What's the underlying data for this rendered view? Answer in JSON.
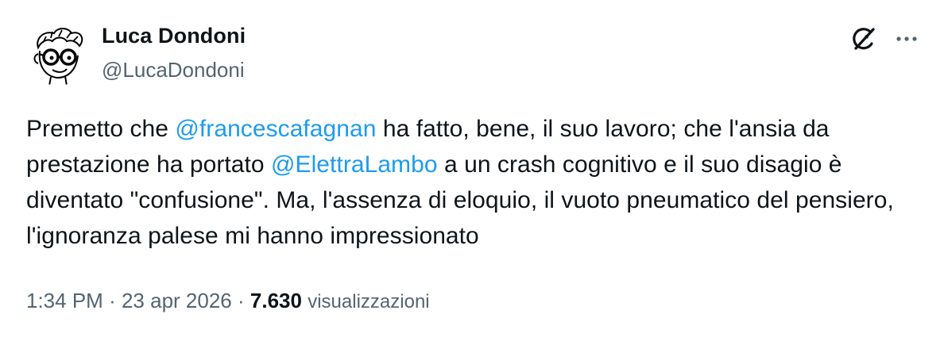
{
  "author": {
    "display_name": "Luca Dondoni",
    "handle": "@LucaDondoni"
  },
  "icons": {
    "grok": "grok-icon",
    "more": "more-options-icon"
  },
  "tweet": {
    "segments": [
      {
        "text": "Premetto che ",
        "mention": false
      },
      {
        "text": "@francescafagnan",
        "mention": true
      },
      {
        "text": " ha fatto, bene, il suo lavoro; che l'ansia da prestazione ha portato ",
        "mention": false
      },
      {
        "text": "@ElettraLambo",
        "mention": true
      },
      {
        "text": " a un crash cognitivo e il suo disagio è diventato \"confusione\". Ma, l'assenza di eloquio, il vuoto pneumatico del pensiero, l'ignoranza palese mi hanno impressionato",
        "mention": false
      }
    ]
  },
  "meta": {
    "time": "1:34 PM",
    "separator": "·",
    "date": "23 apr 2026",
    "views_count": "7.630",
    "views_label": "visualizzazioni"
  },
  "colors": {
    "text": "#0f1419",
    "secondary": "#536471",
    "link": "#1d9bf0",
    "background": "#ffffff"
  }
}
